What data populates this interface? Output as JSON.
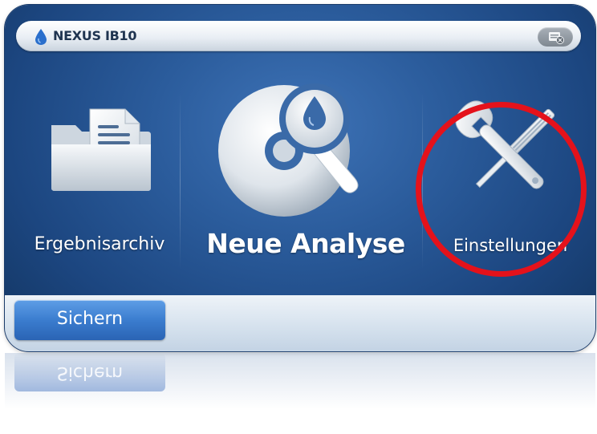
{
  "app": {
    "title": "NEXUS IB10"
  },
  "menu": {
    "items": [
      {
        "label": "Ergebnisarchiv",
        "icon": "folder-document-icon"
      },
      {
        "label": "Neue Analyse",
        "icon": "magnifier-drop-icon"
      },
      {
        "label": "Einstellungen",
        "icon": "wrench-screwdriver-icon"
      }
    ]
  },
  "footer": {
    "save_label": "Sichern"
  },
  "reflection": {
    "save_label": "Sichern"
  },
  "colors": {
    "panel_blue": "#2b5c9c",
    "button_blue": "#3b7dcf",
    "highlight_red": "#e4121b"
  }
}
